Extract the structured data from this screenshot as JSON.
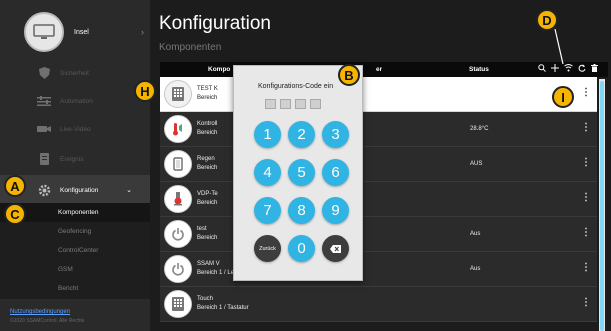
{
  "sidebar": {
    "device_name": "Insel",
    "nav": [
      {
        "label": "Sicherheit",
        "icon": "shield-icon"
      },
      {
        "label": "Automation",
        "icon": "sliders-icon"
      },
      {
        "label": "Live-Video",
        "icon": "camera-icon"
      },
      {
        "label": "Ereignis",
        "icon": "list-icon"
      },
      {
        "label": "Konfiguration",
        "icon": "gear-icon"
      }
    ],
    "sub": [
      "Komponenten",
      "Geofencing",
      "ControlCenter",
      "GSM",
      "Bericht"
    ],
    "footer_link": "Nutzungsbedingungen",
    "footer_copy": "©2020 SSAMControl. Alle Rechte"
  },
  "main": {
    "title": "Konfiguration",
    "subtitle": "Komponenten",
    "headers": {
      "komponente": "Kompo",
      "zuletzt": "er",
      "status": "Status"
    },
    "rows": [
      {
        "icon": "keypad-icon",
        "name": "TEST K",
        "area": "Bereich",
        "status": ""
      },
      {
        "icon": "thermometer-icon",
        "name": "Kontroll",
        "area": "Bereich",
        "status": "28.8°C"
      },
      {
        "icon": "door-contact-icon",
        "name": "Regen",
        "area": "Bereich",
        "status": "AUS"
      },
      {
        "icon": "sensor-icon",
        "name": "VDP-Te",
        "area": "Bereich",
        "status": ""
      },
      {
        "icon": "power-icon",
        "name": "test",
        "area": "Bereich",
        "status": "Aus"
      },
      {
        "icon": "power-icon",
        "name": "SSAM V",
        "area": "Bereich 1 / Leistungs Schaltaktor",
        "status": "Aus"
      },
      {
        "icon": "keypad-icon",
        "name": "Touch",
        "area": "Bereich 1 / Tastatur",
        "status": ""
      }
    ]
  },
  "modal": {
    "title": "Konfigurations-Code ein",
    "keys": [
      "1",
      "2",
      "3",
      "4",
      "5",
      "6",
      "7",
      "8",
      "9",
      "Zurück",
      "0"
    ]
  },
  "badges": [
    "A",
    "B",
    "C",
    "D",
    "H",
    "I"
  ],
  "colors": {
    "key": "#2fb4e3",
    "badge": "#f5b400",
    "link": "#5aa0ff"
  }
}
